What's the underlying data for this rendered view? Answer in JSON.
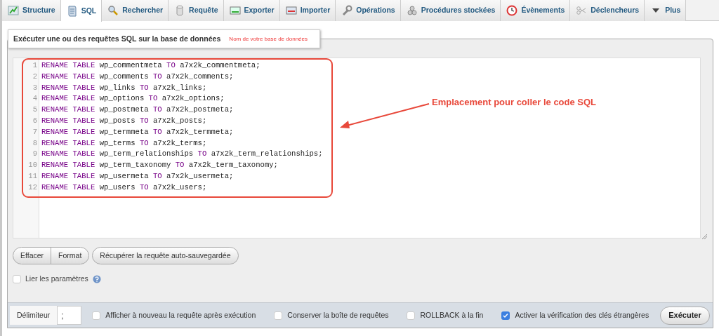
{
  "tabs": [
    {
      "label": "Structure",
      "selected": false
    },
    {
      "label": "SQL",
      "selected": true
    },
    {
      "label": "Rechercher",
      "selected": false
    },
    {
      "label": "Requête",
      "selected": false
    },
    {
      "label": "Exporter",
      "selected": false
    },
    {
      "label": "Importer",
      "selected": false
    },
    {
      "label": "Opérations",
      "selected": false
    },
    {
      "label": "Procédures stockées",
      "selected": false
    },
    {
      "label": "Évènements",
      "selected": false
    },
    {
      "label": "Déclencheurs",
      "selected": false
    },
    {
      "label": "Plus",
      "selected": false
    }
  ],
  "legend": {
    "title": "Exécuter une ou des requêtes SQL sur la base de données",
    "database_hint": "Nom de votre base de données"
  },
  "editor": {
    "lines": [
      {
        "number": "1",
        "tokens": [
          {
            "kind": "keyword",
            "text": "RENAME"
          },
          {
            "kind": "keyword",
            "text": "TABLE"
          },
          {
            "kind": "name",
            "text": "wp_commentmeta"
          },
          {
            "kind": "keyword",
            "text": "TO"
          },
          {
            "kind": "name",
            "text": "a7x2k_commentmeta;"
          }
        ]
      },
      {
        "number": "2",
        "tokens": [
          {
            "kind": "keyword",
            "text": "RENAME"
          },
          {
            "kind": "keyword",
            "text": "TABLE"
          },
          {
            "kind": "name",
            "text": "wp_comments"
          },
          {
            "kind": "keyword",
            "text": "TO"
          },
          {
            "kind": "name",
            "text": "a7x2k_comments;"
          }
        ]
      },
      {
        "number": "3",
        "tokens": [
          {
            "kind": "keyword",
            "text": "RENAME"
          },
          {
            "kind": "keyword",
            "text": "TABLE"
          },
          {
            "kind": "name",
            "text": "wp_links"
          },
          {
            "kind": "keyword",
            "text": "TO"
          },
          {
            "kind": "name",
            "text": "a7x2k_links;"
          }
        ]
      },
      {
        "number": "4",
        "tokens": [
          {
            "kind": "keyword",
            "text": "RENAME"
          },
          {
            "kind": "keyword",
            "text": "TABLE"
          },
          {
            "kind": "name",
            "text": "wp_options"
          },
          {
            "kind": "keyword",
            "text": "TO"
          },
          {
            "kind": "name",
            "text": "a7x2k_options;"
          }
        ]
      },
      {
        "number": "5",
        "tokens": [
          {
            "kind": "keyword",
            "text": "RENAME"
          },
          {
            "kind": "keyword",
            "text": "TABLE"
          },
          {
            "kind": "name",
            "text": "wp_postmeta"
          },
          {
            "kind": "keyword",
            "text": "TO"
          },
          {
            "kind": "name",
            "text": "a7x2k_postmeta;"
          }
        ]
      },
      {
        "number": "6",
        "tokens": [
          {
            "kind": "keyword",
            "text": "RENAME"
          },
          {
            "kind": "keyword",
            "text": "TABLE"
          },
          {
            "kind": "name",
            "text": "wp_posts"
          },
          {
            "kind": "keyword",
            "text": "TO"
          },
          {
            "kind": "name",
            "text": "a7x2k_posts;"
          }
        ]
      },
      {
        "number": "7",
        "tokens": [
          {
            "kind": "keyword",
            "text": "RENAME"
          },
          {
            "kind": "keyword",
            "text": "TABLE"
          },
          {
            "kind": "name",
            "text": "wp_termmeta"
          },
          {
            "kind": "keyword",
            "text": "TO"
          },
          {
            "kind": "name",
            "text": "a7x2k_termmeta;"
          }
        ]
      },
      {
        "number": "8",
        "tokens": [
          {
            "kind": "keyword",
            "text": "RENAME"
          },
          {
            "kind": "keyword",
            "text": "TABLE"
          },
          {
            "kind": "name",
            "text": "wp_terms"
          },
          {
            "kind": "keyword",
            "text": "TO"
          },
          {
            "kind": "name",
            "text": "a7x2k_terms;"
          }
        ]
      },
      {
        "number": "9",
        "tokens": [
          {
            "kind": "keyword",
            "text": "RENAME"
          },
          {
            "kind": "keyword",
            "text": "TABLE"
          },
          {
            "kind": "name",
            "text": "wp_term_relationships"
          },
          {
            "kind": "keyword",
            "text": "TO"
          },
          {
            "kind": "name",
            "text": "a7x2k_term_relationships;"
          }
        ]
      },
      {
        "number": "10",
        "tokens": [
          {
            "kind": "keyword",
            "text": "RENAME"
          },
          {
            "kind": "keyword",
            "text": "TABLE"
          },
          {
            "kind": "name",
            "text": "wp_term_taxonomy"
          },
          {
            "kind": "keyword",
            "text": "TO"
          },
          {
            "kind": "name",
            "text": "a7x2k_term_taxonomy;"
          }
        ]
      },
      {
        "number": "11",
        "tokens": [
          {
            "kind": "keyword",
            "text": "RENAME"
          },
          {
            "kind": "keyword",
            "text": "TABLE"
          },
          {
            "kind": "name",
            "text": "wp_usermeta"
          },
          {
            "kind": "keyword",
            "text": "TO"
          },
          {
            "kind": "name",
            "text": "a7x2k_usermeta;"
          }
        ]
      },
      {
        "number": "12",
        "tokens": [
          {
            "kind": "keyword",
            "text": "RENAME"
          },
          {
            "kind": "keyword",
            "text": "TABLE"
          },
          {
            "kind": "name",
            "text": "wp_users"
          },
          {
            "kind": "keyword",
            "text": "TO"
          },
          {
            "kind": "name",
            "text": "a7x2k_users;"
          }
        ]
      }
    ]
  },
  "annotation": {
    "text": "Emplacement pour coller le code SQL"
  },
  "buttons": [
    "Effacer",
    "Format"
  ],
  "restore_button": "Récupérer la requête auto-sauvegardée",
  "bind_parameters": {
    "label": "Lier les paramètres",
    "checked": false
  },
  "footer": {
    "delimiter_label": "Délimiteur",
    "delimiter_value": ";",
    "options": [
      {
        "label": "Afficher à nouveau la requête après exécution",
        "checked": false
      },
      {
        "label": "Conserver la boîte de requêtes",
        "checked": false
      },
      {
        "label": "ROLLBACK à la fin",
        "checked": false
      },
      {
        "label": "Activer la vérification des clés étrangères",
        "checked": true
      }
    ],
    "submit": "Exécuter"
  }
}
